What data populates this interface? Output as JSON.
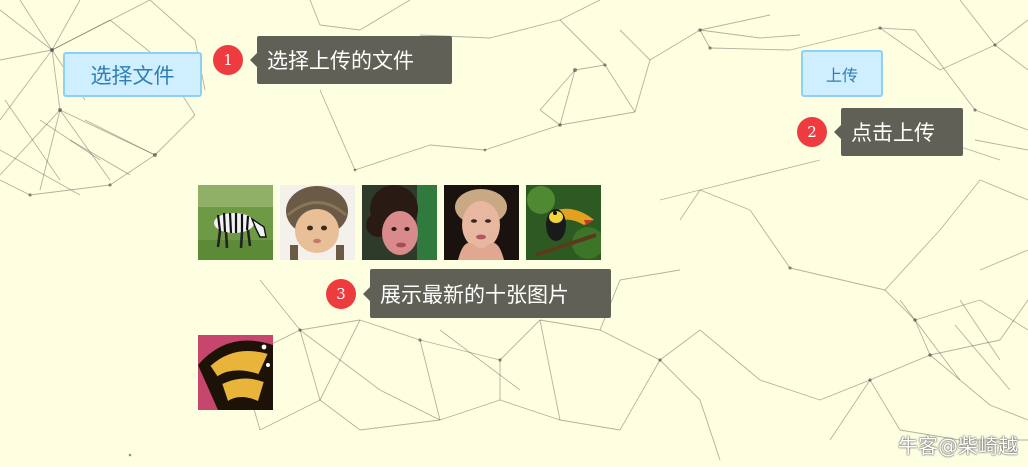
{
  "buttons": {
    "choose_file_label": "选择文件",
    "upload_label": "上传"
  },
  "annotations": [
    {
      "number": "1",
      "text": "选择上传的文件"
    },
    {
      "number": "2",
      "text": "点击上传"
    },
    {
      "number": "3",
      "text": "展示最新的十张图片"
    }
  ],
  "gallery": {
    "images": [
      {
        "subject": "zebra"
      },
      {
        "subject": "baby-in-knit-hat"
      },
      {
        "subject": "curly-haired-child"
      },
      {
        "subject": "woman-portrait"
      },
      {
        "subject": "toucan"
      },
      {
        "subject": "butterfly-wing"
      }
    ]
  },
  "watermark": {
    "text": "牛客@柴崎越"
  },
  "colors": {
    "background": "#fefee0",
    "button_fill": "#cfeeff",
    "button_border": "#8fd0f5",
    "button_text": "#2d7fb4",
    "badge": "#ee3b3f",
    "tooltip": "#616056"
  }
}
